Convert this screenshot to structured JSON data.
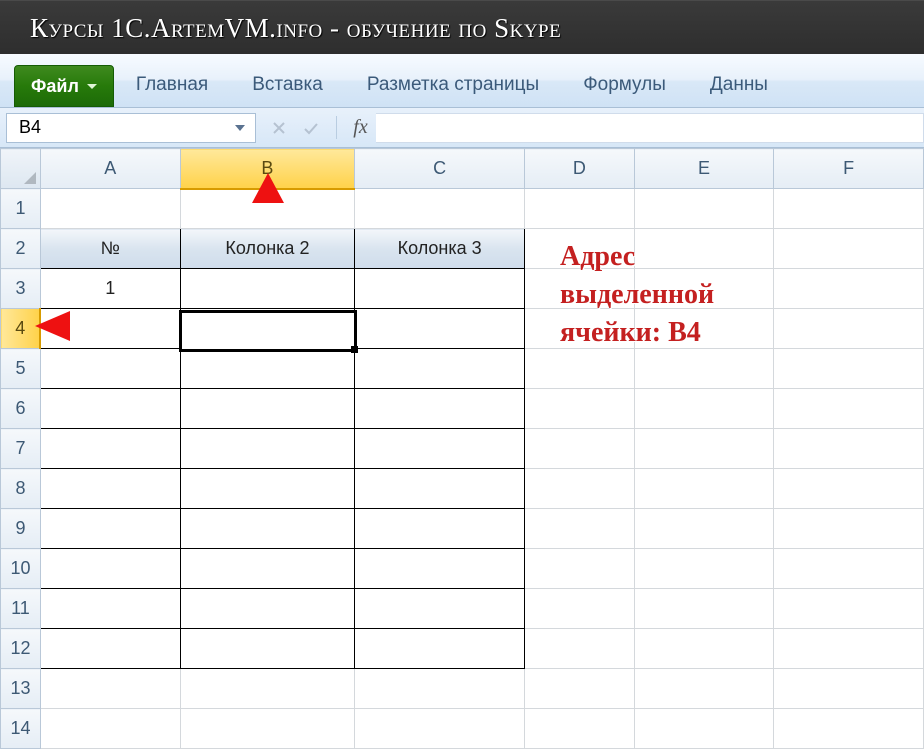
{
  "title": "Курсы 1C.ArtemVM.info - обучение по Skype",
  "ribbon": {
    "file": "Файл",
    "tabs": [
      "Главная",
      "Вставка",
      "Разметка страницы",
      "Формулы",
      "Данны"
    ]
  },
  "namebox": {
    "value": "B4"
  },
  "fx": {
    "label": "fx"
  },
  "columns": [
    "A",
    "B",
    "C",
    "D",
    "E",
    "F"
  ],
  "rows": [
    "1",
    "2",
    "3",
    "4",
    "5",
    "6",
    "7",
    "8",
    "9",
    "10",
    "11",
    "12",
    "13",
    "14"
  ],
  "selected": {
    "col": "B",
    "row": "4"
  },
  "cells": {
    "A2": "№",
    "B2": "Колонка 2",
    "C2": "Колонка 3",
    "A3": "1"
  },
  "annotation": {
    "line1": "Адрес",
    "line2": "выделенной",
    "line3": "ячейки: B4"
  }
}
